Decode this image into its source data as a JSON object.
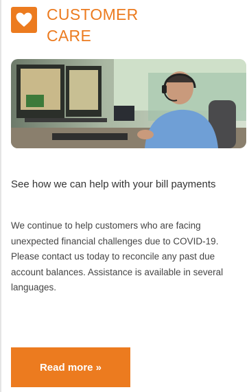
{
  "header": {
    "title_line1": "CUSTOMER",
    "title_line2": "CARE",
    "icon": "heart-icon"
  },
  "photo": {
    "subject": "customer-service-agent-with-headset-at-desk"
  },
  "article": {
    "subtitle": "See how we can help with your bill payments",
    "body": "We continue to help customers who are facing unexpected financial challenges due to COVID-19. Please contact us today to reconcile any past due account balances. Assistance is available in several languages."
  },
  "cta": {
    "label": "Read more »"
  },
  "colors": {
    "accent": "#ec7b1f",
    "text": "#444444"
  }
}
